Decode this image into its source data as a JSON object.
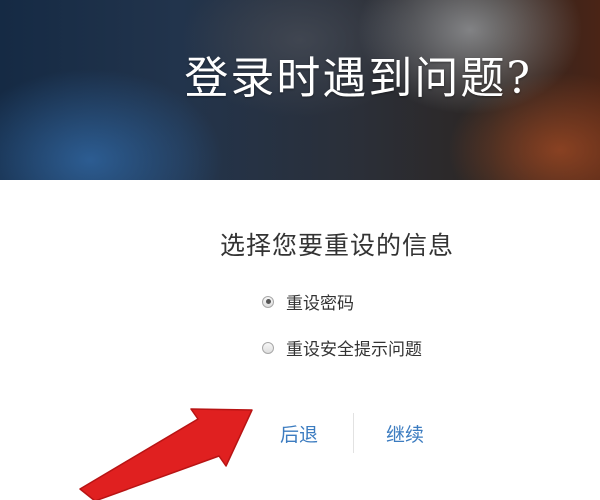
{
  "banner": {
    "title": "登录时遇到问题?"
  },
  "form": {
    "heading": "选择您要重设的信息",
    "options": [
      {
        "label": "重设密码",
        "selected": true
      },
      {
        "label": "重设安全提示问题",
        "selected": false
      }
    ]
  },
  "actions": {
    "back_label": "后退",
    "continue_label": "继续"
  },
  "annotation": {
    "arrow_color": "#e02020",
    "arrow_target": "back-link"
  },
  "colors": {
    "link": "#3c7cc0",
    "text": "#333333"
  }
}
